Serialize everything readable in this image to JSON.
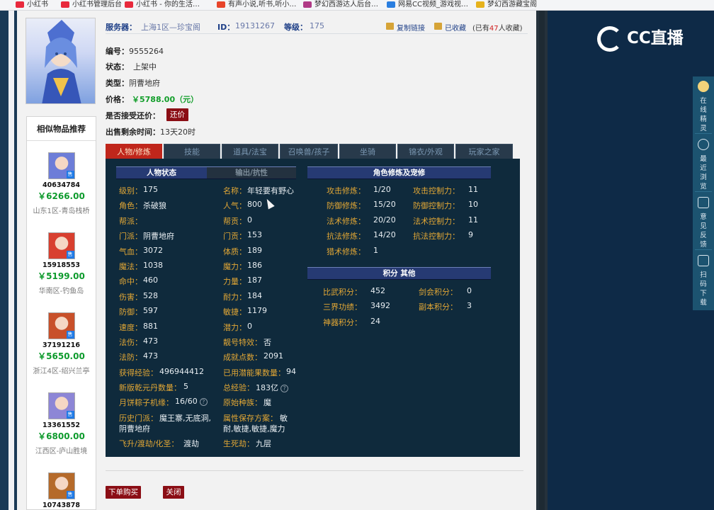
{
  "bookmarks": [
    {
      "label": "小红书",
      "color": "#e8293c"
    },
    {
      "label": "小红书管理后台",
      "color": "#e8293c"
    },
    {
      "label": "小红书 - 你的生活…",
      "color": "#e8293c"
    },
    {
      "label": "有声小说,听书,听小…",
      "color": "#e8452b"
    },
    {
      "label": "梦幻西游达人后台…",
      "color": "#b03a86"
    },
    {
      "label": "网易CC视频_游戏视…",
      "color": "#2a7ee0"
    },
    {
      "label": "梦幻西游藏宝阁",
      "color": "#e6b21d"
    }
  ],
  "item": {
    "server_label": "服务器：",
    "server_value": "上海1区—珍宝阁",
    "id_label": "ID：",
    "id_value": "19131267",
    "level_label": "等级：",
    "level_value": "175",
    "copy_link": "复制链接",
    "favorited": "已收藏",
    "fav_count_pre": "(已有",
    "fav_count": "47",
    "fav_count_post": "人收藏)",
    "number_label": "编号：",
    "number_value": "9555264",
    "status_label": "状态：",
    "status_value": "上架中",
    "type_label": "类型：",
    "type_value": "阴曹地府",
    "price_label": "价格：",
    "price_value": "￥5788.00（元）",
    "bargain_label": "是否接受还价：",
    "bargain_button": "还价",
    "time_label": "出售剩余时间：",
    "time_value": "13天20时"
  },
  "similar": {
    "title": "相似物品推荐",
    "tag": "售",
    "items": [
      {
        "id": "40634784",
        "price": "￥6266.00",
        "server": "山东1区-青岛栈桥",
        "bg": "#6d7dd8"
      },
      {
        "id": "15918553",
        "price": "￥5199.00",
        "server": "华南区-钓鱼岛",
        "bg": "#d83f2f"
      },
      {
        "id": "37191216",
        "price": "￥5650.00",
        "server": "浙江4区-绍兴兰亭",
        "bg": "#c8502a"
      },
      {
        "id": "13361552",
        "price": "￥6800.00",
        "server": "江西区-庐山胜境",
        "bg": "#8d86d6"
      },
      {
        "id": "10743878",
        "price": "",
        "server": "",
        "bg": "#b56a2a"
      }
    ]
  },
  "tabs": [
    "人物/修炼",
    "技能",
    "道具/法宝",
    "召唤兽/孩子",
    "坐骑",
    "锦衣/外观",
    "玩家之家"
  ],
  "panel": {
    "hdr_status": "人物状态",
    "hdr_output": "输出/抗性",
    "hdr_cultivation": "角色修炼及宠修",
    "hdr_points": "积分  其他",
    "left_rows": [
      {
        "l1": "级别：",
        "v1": "175",
        "l2": "名称：",
        "v2": "年轻要有野心"
      },
      {
        "l1": "角色：",
        "v1": "杀破狼",
        "l2": "人气：",
        "v2": "800"
      },
      {
        "l1": "帮派：",
        "v1": "",
        "l2": "帮贡：",
        "v2": "0"
      },
      {
        "l1": "门派：",
        "v1": "阴曹地府",
        "l2": "门贡：",
        "v2": "153"
      },
      {
        "l1": "气血：",
        "v1": "3072",
        "l2": "体质：",
        "v2": "189"
      },
      {
        "l1": "魔法：",
        "v1": "1038",
        "l2": "魔力：",
        "v2": "186"
      },
      {
        "l1": "命中：",
        "v1": "460",
        "l2": "力量：",
        "v2": "187"
      },
      {
        "l1": "伤害：",
        "v1": "528",
        "l2": "耐力：",
        "v2": "184"
      },
      {
        "l1": "防御：",
        "v1": "597",
        "l2": "敏捷：",
        "v2": "1179"
      },
      {
        "l1": "速度：",
        "v1": "881",
        "l2": "潜力：",
        "v2": "0"
      },
      {
        "l1": "法伤：",
        "v1": "473",
        "l2": "靓号特效：",
        "v2": "否"
      },
      {
        "l1": "法防：",
        "v1": "473",
        "l2": "成就点数：",
        "v2": "2091"
      },
      {
        "l1": "获得经验：",
        "v1": "496944412",
        "l2": "已用潜能果数量：",
        "v2": "94"
      }
    ],
    "yuandan_label": "新版乾元丹数量：",
    "yuandan_value": "5",
    "total_exp_label": "总经验：",
    "total_exp_value": "183亿",
    "zongzi_label": "月饼粽子机缘：",
    "zongzi_value": "16/60",
    "race_label": "原始种族：",
    "race_value": "魔",
    "history_label": "历史门派：",
    "history_value1": "魔王寨,无底洞,",
    "history_value2": "阴曹地府",
    "attr_label": "属性保存方案：",
    "attr_value1": "敏",
    "attr_value2": "耐,敏捷,敏捷,魔力",
    "ascend_label": "飞升/渡劫/化圣：",
    "ascend_value": "渡劫",
    "life_label": "生死劫：",
    "life_value": "九层",
    "cultivation": [
      {
        "l1": "攻击修炼：",
        "v1": "1/20",
        "l2": "攻击控制力：",
        "v2": "11"
      },
      {
        "l1": "防御修炼：",
        "v1": "15/20",
        "l2": "防御控制力：",
        "v2": "10"
      },
      {
        "l1": "法术修炼：",
        "v1": "20/20",
        "l2": "法术控制力：",
        "v2": "11"
      },
      {
        "l1": "抗法修炼：",
        "v1": "14/20",
        "l2": "抗法控制力：",
        "v2": "9"
      },
      {
        "l1": "猎术修炼：",
        "v1": "1",
        "l2": "",
        "v2": ""
      }
    ],
    "points": [
      {
        "l1": "比武积分：",
        "v1": "452",
        "l2": "剑会积分：",
        "v2": "0"
      },
      {
        "l1": "三界功绩：",
        "v1": "3492",
        "l2": "副本积分：",
        "v2": "3"
      },
      {
        "l1": "神器积分：",
        "v1": "24",
        "l2": "",
        "v2": ""
      }
    ]
  },
  "buttons": {
    "buy": "下单购买",
    "close": "关闭"
  },
  "cc": {
    "logo": "CC直播",
    "side": [
      {
        "label": "在线精灵",
        "icon": "elf-icon"
      },
      {
        "label": "最近浏览",
        "icon": "clock-icon"
      },
      {
        "label": "意见反馈",
        "icon": "edit-icon"
      },
      {
        "label": "扫码下载",
        "icon": "qr-scan-icon"
      }
    ]
  }
}
